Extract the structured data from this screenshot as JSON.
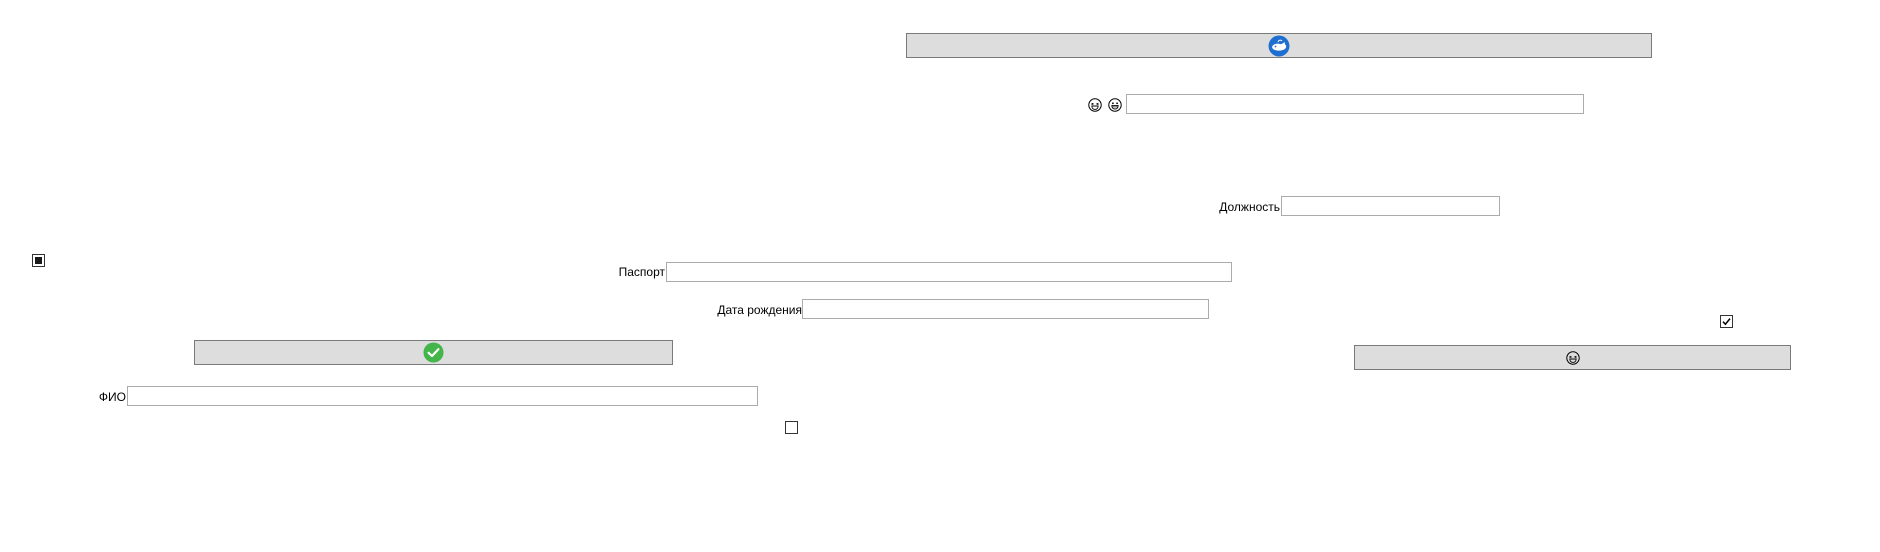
{
  "window": {
    "background": "#ffffff"
  },
  "form": {
    "buttons": [
      {
        "name": "top-icon-button",
        "icon": "whale-icon",
        "icon_color": "#1f6fd1"
      },
      {
        "name": "confirm-button",
        "icon": "check-circle-icon",
        "icon_color": "#43b54a"
      },
      {
        "name": "emoji-button",
        "icon": "laughing-face-icon"
      }
    ],
    "emoji_labels": [
      "laughing-face-icon",
      "grinning-face-icon"
    ],
    "fields": {
      "emoji": {
        "label": "",
        "value": ""
      },
      "position": {
        "label": "Должность",
        "value": ""
      },
      "passport": {
        "label": "Паспорт",
        "value": ""
      },
      "birth_date": {
        "label": "Дата рождения",
        "value": ""
      },
      "full_name": {
        "label": "ФИО",
        "value": ""
      }
    },
    "checkboxes": [
      {
        "name": "checkbox-indeterminate",
        "state": "indeterminate"
      },
      {
        "name": "checkbox-checked",
        "state": "checked"
      },
      {
        "name": "checkbox-unchecked",
        "state": "unchecked"
      }
    ],
    "colors": {
      "button_bg": "#dddddd",
      "button_border": "#7a7a7a",
      "field_border": "#ababab"
    }
  }
}
